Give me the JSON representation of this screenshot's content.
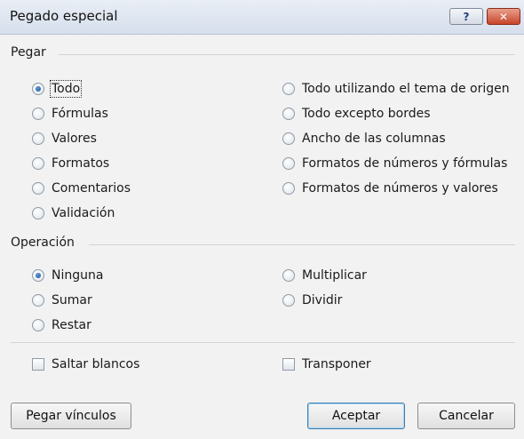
{
  "dialog": {
    "title": "Pegado especial",
    "help_icon_glyph": "?",
    "close_icon_glyph": "✕"
  },
  "paste": {
    "section_label": "Pegar",
    "options_left": [
      "Todo",
      "Fórmulas",
      "Valores",
      "Formatos",
      "Comentarios",
      "Validación"
    ],
    "options_right": [
      "Todo utilizando el tema de origen",
      "Todo excepto bordes",
      "Ancho de las columnas",
      "Formatos de números y fórmulas",
      "Formatos de números y valores"
    ],
    "selected": "Todo"
  },
  "operation": {
    "section_label": "Operación",
    "options_left": [
      "Ninguna",
      "Sumar",
      "Restar"
    ],
    "options_right": [
      "Multiplicar",
      "Dividir"
    ],
    "selected": "Ninguna"
  },
  "checks": {
    "skip_blanks": "Saltar blancos",
    "skip_blanks_checked": false,
    "transpose": "Transponer",
    "transpose_checked": false
  },
  "buttons": {
    "paste_links": "Pegar vínculos",
    "accept": "Aceptar",
    "cancel": "Cancelar"
  }
}
